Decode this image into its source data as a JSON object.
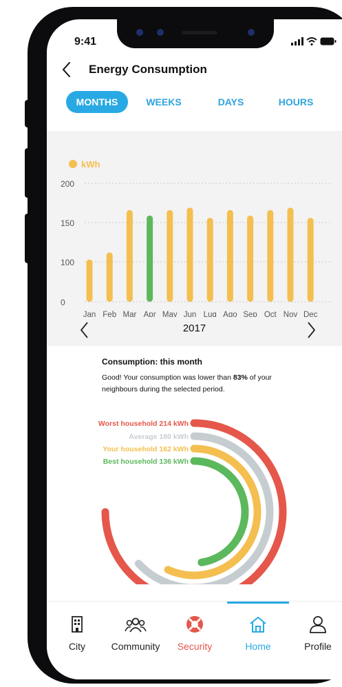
{
  "status_bar": {
    "time": "9:41"
  },
  "header": {
    "title": "Energy Consumption"
  },
  "tabs": [
    {
      "label": "MONTHS",
      "active": true
    },
    {
      "label": "WEEKS",
      "active": false
    },
    {
      "label": "DAYS",
      "active": false
    },
    {
      "label": "HOURS",
      "active": false
    }
  ],
  "chart_data": {
    "type": "bar",
    "legend": "kWh",
    "categories": [
      "Jan",
      "Feb",
      "Mar",
      "Apr",
      "May",
      "Jun",
      "Lug",
      "Ago",
      "Sep",
      "Oct",
      "Nov",
      "Dec"
    ],
    "values": [
      103,
      112,
      166,
      159,
      166,
      169,
      156,
      166,
      159,
      166,
      169,
      156
    ],
    "ylim": [
      0,
      200
    ],
    "yticks": [
      0,
      100,
      150,
      200
    ],
    "highlight_index": 3,
    "colors": {
      "bar": "#f4bf50",
      "highlight": "#5cb85c",
      "grid": "#c9c9c9",
      "axis_text": "#555555"
    },
    "grid": true,
    "legend_position": "top-left"
  },
  "year_selector": {
    "value": "2017"
  },
  "summary": {
    "title": "Consumption: this month",
    "text_before": "Good! Your consumption was lower than ",
    "percent": "83%",
    "text_after": " of your neighbours during the selected period."
  },
  "comparison": {
    "max_kwh": 214,
    "items": [
      {
        "label": "Worst household 214 kWh",
        "value": 214,
        "color": "#e5574b"
      },
      {
        "label": "Average 180 kWh",
        "value": 180,
        "color": "#c6cdd1"
      },
      {
        "label": "Your household 162 kWh",
        "value": 162,
        "color": "#f4bf50"
      },
      {
        "label": "Best household 136 kWh",
        "value": 136,
        "color": "#5cb85c"
      }
    ]
  },
  "nav": [
    {
      "label": "City",
      "icon": "building-icon",
      "active": false,
      "color": "#222222"
    },
    {
      "label": "Community",
      "icon": "group-icon",
      "active": false,
      "color": "#222222"
    },
    {
      "label": "Security",
      "icon": "lifebuoy-icon",
      "active": false,
      "color": "#e5574b"
    },
    {
      "label": "Home",
      "icon": "home-icon",
      "active": true,
      "color": "#29a9e4"
    },
    {
      "label": "Profile",
      "icon": "user-icon",
      "active": false,
      "color": "#222222"
    }
  ]
}
